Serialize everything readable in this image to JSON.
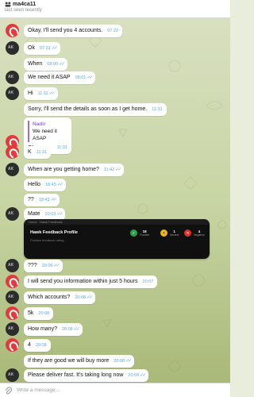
{
  "header": {
    "title": "ma4ca11",
    "subtitle": "last seen recently"
  },
  "messages": [
    {
      "text": "Okay, I'll send you 4 accounts.",
      "time": "07:22",
      "avatar": "red"
    },
    {
      "text": "Ok",
      "time": "07:31",
      "avatar": "dark",
      "read": true
    },
    {
      "text": "When",
      "time": "08:00",
      "avatar": "",
      "read": true
    },
    {
      "text": "We need it ASAP",
      "time": "08:01",
      "avatar": "dark",
      "read": true
    },
    {
      "text": "Hi",
      "time": "11:11",
      "avatar": "dark",
      "read": true
    },
    {
      "text": "Sorry, I'll send the details as soon as I get home.",
      "time": "11:31",
      "avatar": ""
    },
    {
      "quote_author": "Nadir",
      "quote_text": "We need it ASAP",
      "text": "OI",
      "time": "11:31",
      "avatar": "red"
    },
    {
      "text": "K",
      "time": "11:31",
      "avatar": "red"
    },
    {
      "text": "When are you getting home?",
      "time": "11:42",
      "avatar": "dark",
      "read": true
    },
    {
      "text": "Hello",
      "time": "18:43",
      "avatar": "",
      "read": true
    },
    {
      "text": "??",
      "time": "18:43",
      "avatar": "",
      "read": true
    },
    {
      "text": "Mate",
      "time": "20:03",
      "avatar": "dark",
      "read": true
    },
    {
      "text": "???",
      "time": "20:06",
      "avatar": "dark",
      "read": true
    },
    {
      "text": "I will send you information within just 5 hours",
      "time": "20:07",
      "avatar": "red"
    },
    {
      "text": "Which accounts?",
      "time": "20:08",
      "avatar": "dark",
      "read": true
    },
    {
      "text": "5k",
      "time": "20:08",
      "avatar": "red"
    },
    {
      "text": "How many?",
      "time": "20:08",
      "avatar": "dark",
      "read": true
    },
    {
      "text": "4",
      "time": "20:08",
      "avatar": "red"
    },
    {
      "text": "If they are good we will buy more",
      "time": "20:08",
      "avatar": "",
      "read": true
    },
    {
      "text": "Please deliver fast. It's taking long now",
      "time": "20:09",
      "avatar": "dark",
      "read": true
    }
  ],
  "embed": {
    "topbar_left": "Home",
    "topbar_right": "Hawk Feedback",
    "title": "Hawk Feedback Profile",
    "subtitle": "Positive feedback rating",
    "stats": [
      {
        "value": "18",
        "label": "Positive",
        "color": "green",
        "glyph": "✓"
      },
      {
        "value": "1",
        "label": "Neutral",
        "color": "yellow",
        "glyph": "•"
      },
      {
        "value": "4",
        "label": "Negative",
        "color": "red",
        "glyph": "✕"
      }
    ]
  },
  "composer": {
    "placeholder": "Write a message..."
  }
}
